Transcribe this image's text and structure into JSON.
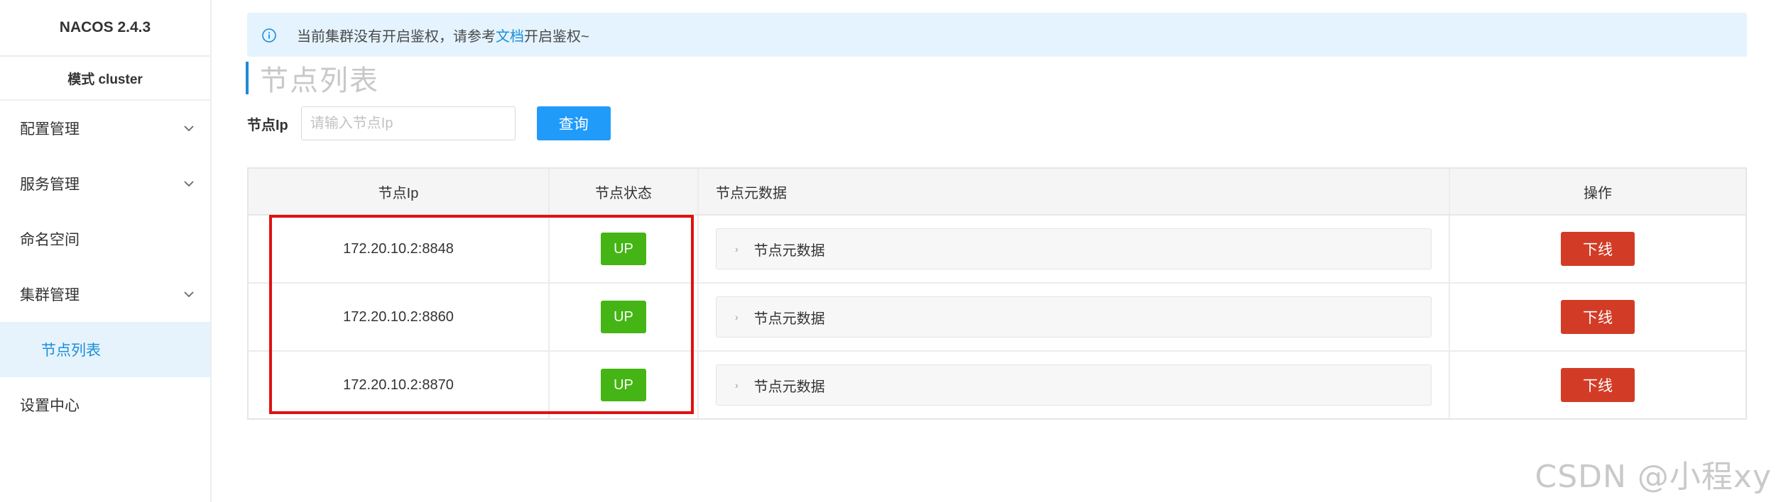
{
  "sidebar": {
    "brand": "NACOS 2.4.3",
    "mode": "模式 cluster",
    "items": [
      {
        "label": "配置管理"
      },
      {
        "label": "服务管理"
      },
      {
        "label": "命名空间"
      },
      {
        "label": "集群管理"
      },
      {
        "label": "节点列表"
      },
      {
        "label": "设置中心"
      }
    ]
  },
  "notice": {
    "text_before": "当前集群没有开启鉴权，请参考",
    "link": "文档",
    "text_after": "开启鉴权~"
  },
  "page": {
    "title": "节点列表"
  },
  "search": {
    "label": "节点Ip",
    "placeholder": "请输入节点Ip",
    "button": "查询"
  },
  "table": {
    "headers": [
      "节点Ip",
      "节点状态",
      "节点元数据",
      "操作"
    ],
    "rows": [
      {
        "ip": "172.20.10.2:8848",
        "status": "UP",
        "meta": "节点元数据",
        "action": "下线"
      },
      {
        "ip": "172.20.10.2:8860",
        "status": "UP",
        "meta": "节点元数据",
        "action": "下线"
      },
      {
        "ip": "172.20.10.2:8870",
        "status": "UP",
        "meta": "节点元数据",
        "action": "下线"
      }
    ]
  },
  "watermark": "CSDN @小程xy",
  "colors": {
    "accent": "#209bfa",
    "status_up": "#44b514",
    "danger": "#d23c26",
    "highlight": "#e01111"
  }
}
